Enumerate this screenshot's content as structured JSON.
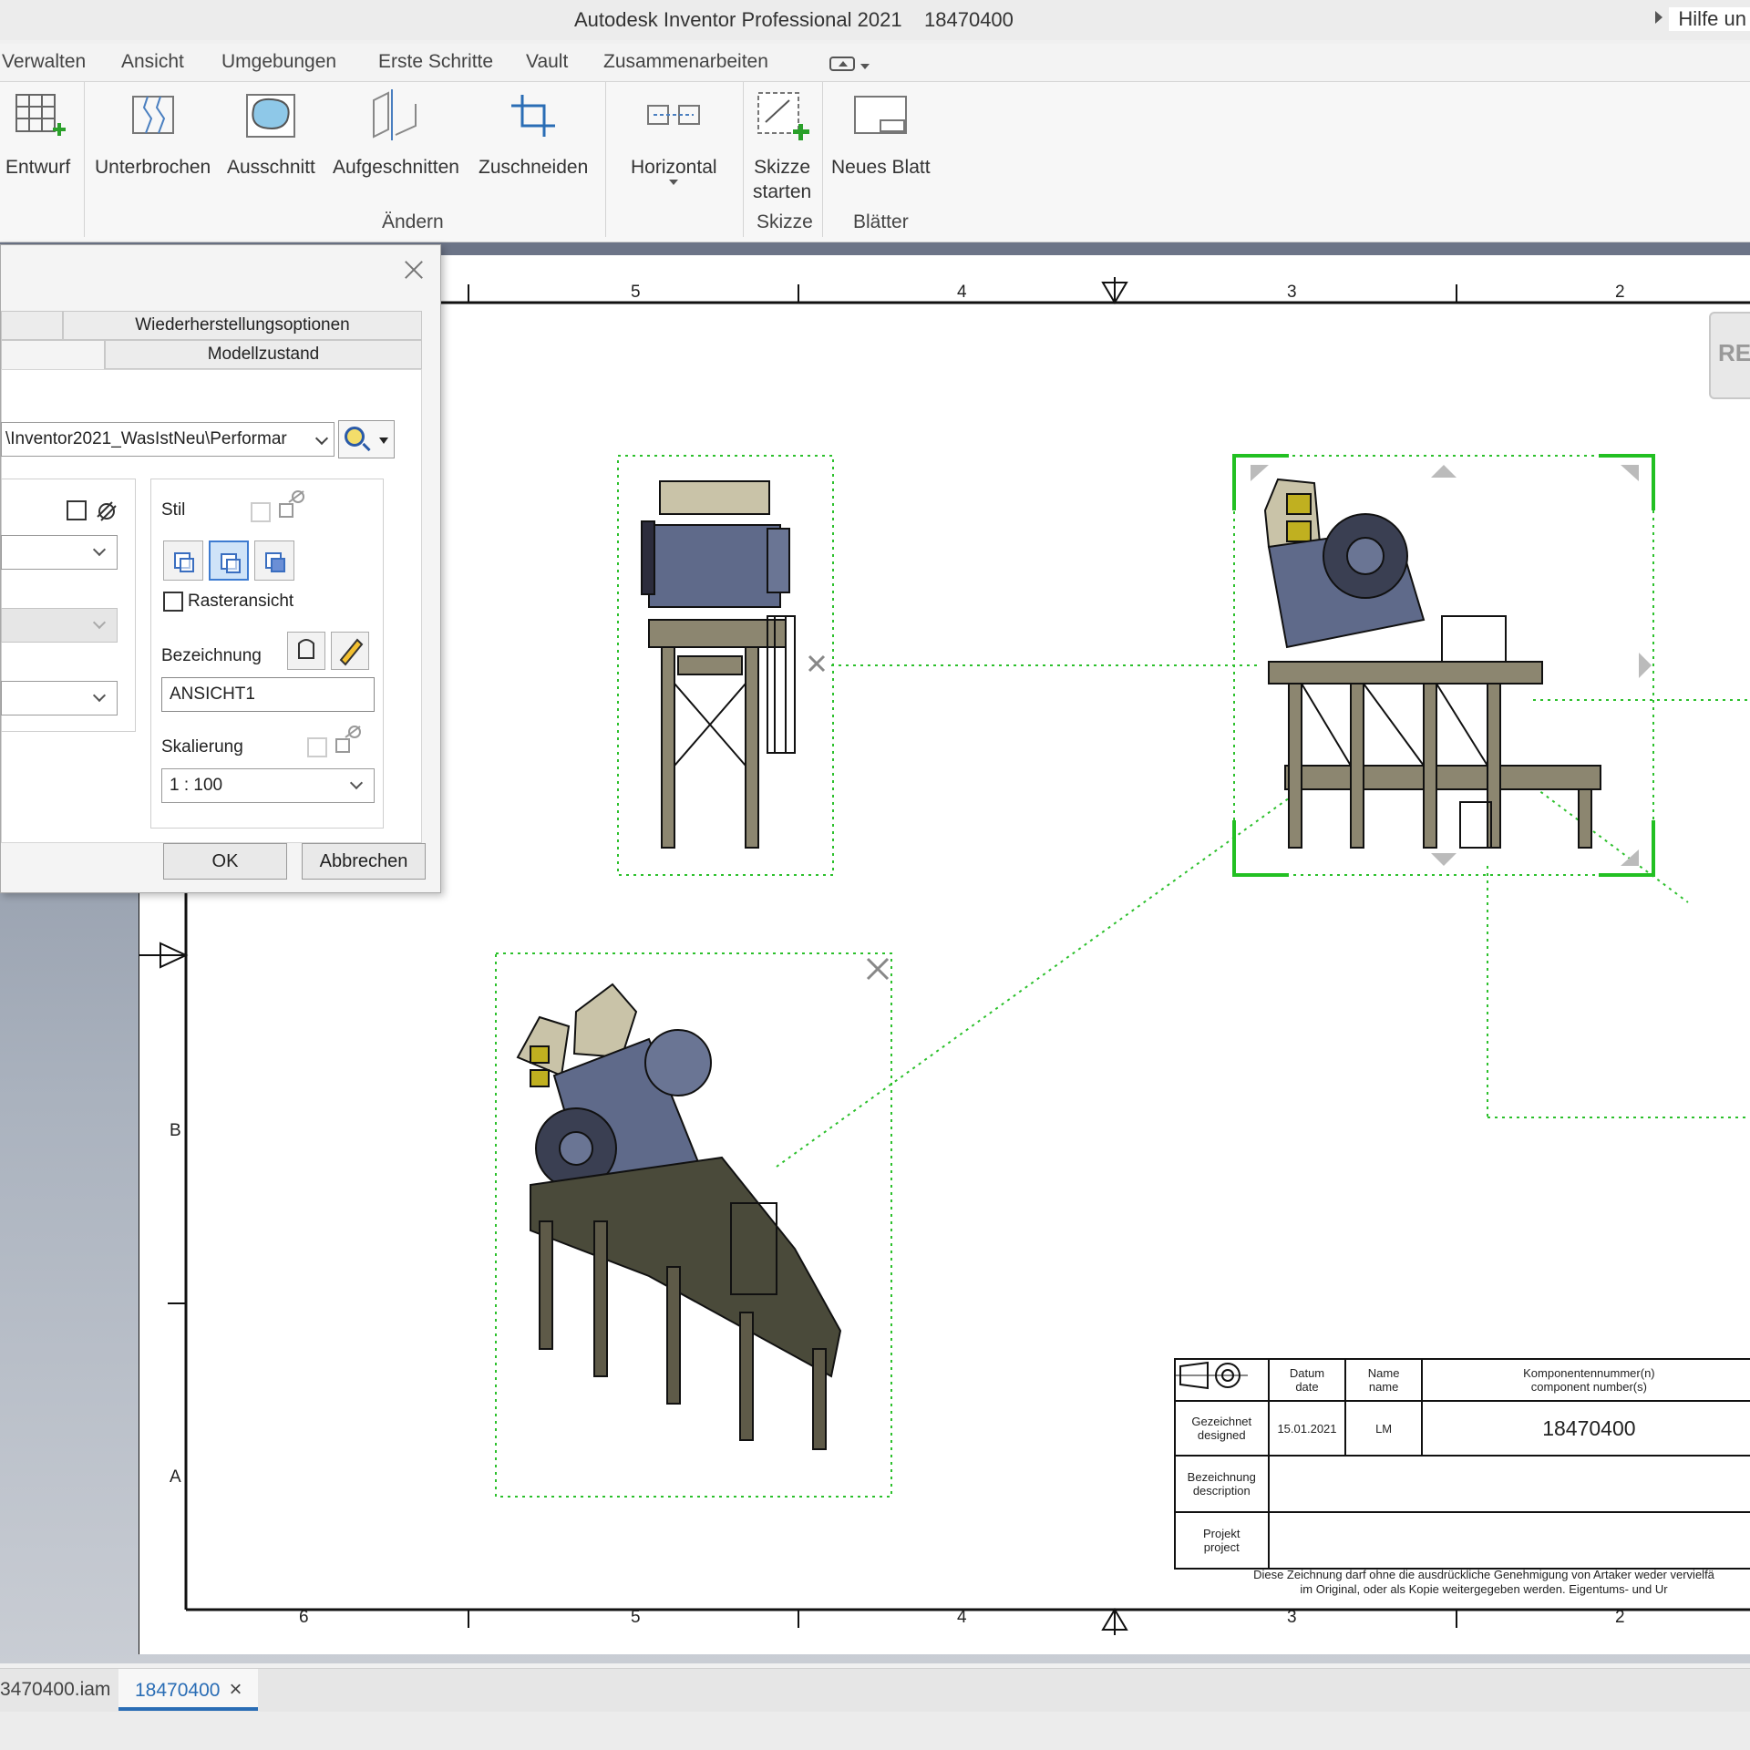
{
  "titlebar": {
    "title": "Autodesk Inventor Professional 2021    18470400",
    "help": "Hilfe un"
  },
  "menu": {
    "tabs": [
      "Verwalten",
      "Ansicht",
      "Umgebungen",
      "Erste Schritte",
      "Vault",
      "Zusammenarbeiten"
    ]
  },
  "ribbon": {
    "buttons": {
      "entwurf": "Entwurf",
      "unterbrochen": "Unterbrochen",
      "ausschnitt": "Ausschnitt",
      "aufgeschnitten": "Aufgeschnitten",
      "zuschneiden": "Zuschneiden",
      "horizontal": "Horizontal",
      "skizze_line1": "Skizze",
      "skizze_line2": "starten",
      "neues_blatt": "Neues Blatt"
    },
    "groups": {
      "aendern": "Ändern",
      "skizze": "Skizze",
      "blaetter": "Blätter"
    }
  },
  "dialog": {
    "tabs": {
      "wiederherstellung": "Wiederherstellungsoptionen",
      "modellzustand": "Modellzustand"
    },
    "path": "\\Inventor2021_WasIstNeu\\Performar",
    "stil_label": "Stil",
    "rasteransicht_label": "Rasteransicht",
    "bezeichnung_label": "Bezeichnung",
    "bezeichnung_value": "ANSICHT1",
    "skalierung_label": "Skalierung",
    "skalierung_value": "1 : 100",
    "ok": "OK",
    "abbrechen": "Abbrechen"
  },
  "sheet": {
    "top_ruler": [
      "5",
      "4",
      "3",
      "2"
    ],
    "bottom_ruler": [
      "6",
      "5",
      "4",
      "3",
      "2"
    ],
    "side_letters": [
      "B",
      "A"
    ],
    "rec_label": "REC"
  },
  "titleblock": {
    "datum": "Datum\ndate",
    "name": "Name\nname",
    "komponenten": "Komponentennummer(n)\ncomponent number(s)",
    "gezeichnet": "Gezeichnet\ndesigned",
    "date_value": "15.01.2021",
    "name_value": "LM",
    "part_number": "18470400",
    "bezeichnung": "Bezeichnung\ndescription",
    "projekt": "Projekt\nproject",
    "note_line1": "Diese Zeichnung darf ohne die ausdrückliche Genehmigung von Artaker weder vervielfä",
    "note_line2": "im Original, oder als Kopie weitergegeben werden. Eigentums- und Ur"
  },
  "doc_tabs": {
    "assembly": "3470400.iam",
    "drawing": "18470400"
  },
  "colors": {
    "accent": "#2a6db5",
    "selection": "#22c022",
    "machine_body": "#5f6a8a",
    "frame": "#8c8670"
  }
}
